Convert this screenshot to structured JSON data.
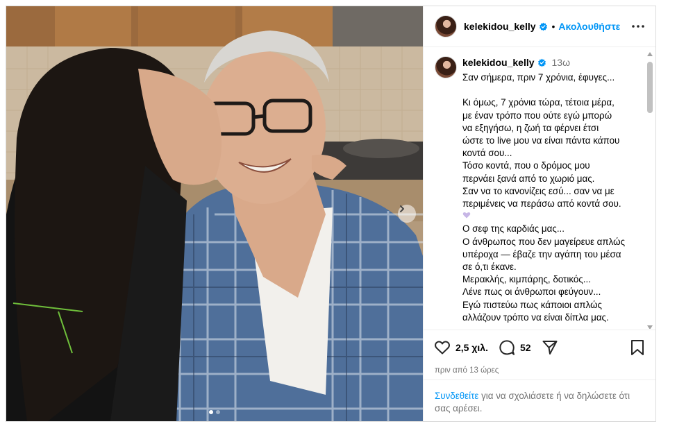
{
  "post": {
    "username": "kelekidou_kelly",
    "follow_label": "Ακολουθήστε",
    "separator": "•",
    "caption_time": "13ω",
    "caption_lines": [
      "Σαν σήμερα, πριν 7 χρόνια, έφυγες...",
      "",
      "Κι όμως, 7 χρόνια τώρα, τέτοια μέρα,",
      "με έναν τρόπο που ούτε εγώ μπορώ",
      "να εξηγήσω, η ζωή τα φέρνει έτσι",
      "ώστε το live μου να είναι πάντα κάπου",
      "κοντά σου...",
      "Τόσο κοντά, που ο δρόμος μου",
      "περνάει ξανά από το χωριό μας.",
      "Σαν να το κανονίζεις εσύ... σαν να με",
      "περιμένεις να περάσω από κοντά σου.",
      "",
      "Ο σεφ της καρδιάς μας...",
      "Ο άνθρωπος που δεν μαγείρευε απλώς",
      "υπέροχα — έβαζε την αγάπη του μέσα",
      "σε ό,τι έκανε.",
      "Μερακλής, κιμπάρης, δοτικός...",
      "Λένε πως οι άνθρωποι φεύγουν...",
      "Εγώ πιστεύω πως κάποιοι απλώς",
      "αλλάζουν τρόπο να είναι δίπλα μας."
    ],
    "likes": "2,5 χιλ.",
    "comments": "52",
    "time_ago": "πριν από 13 ώρες",
    "login_link": "Συνδεθείτε",
    "login_text": " για να σχολιάσετε ή να δηλώσετε ότι σας αρέσει."
  },
  "icons": {
    "verified": "verified-badge-icon",
    "more": "more-options-icon",
    "like": "heart-icon",
    "comment": "comment-icon",
    "share": "share-icon",
    "save": "bookmark-icon",
    "next": "chevron-right-icon",
    "emoji": "purple-heart-icon"
  },
  "colors": {
    "link_blue": "#0095f6",
    "muted_text": "#737373",
    "divider": "#efefef",
    "emoji_heart": "#c7b6e6"
  }
}
